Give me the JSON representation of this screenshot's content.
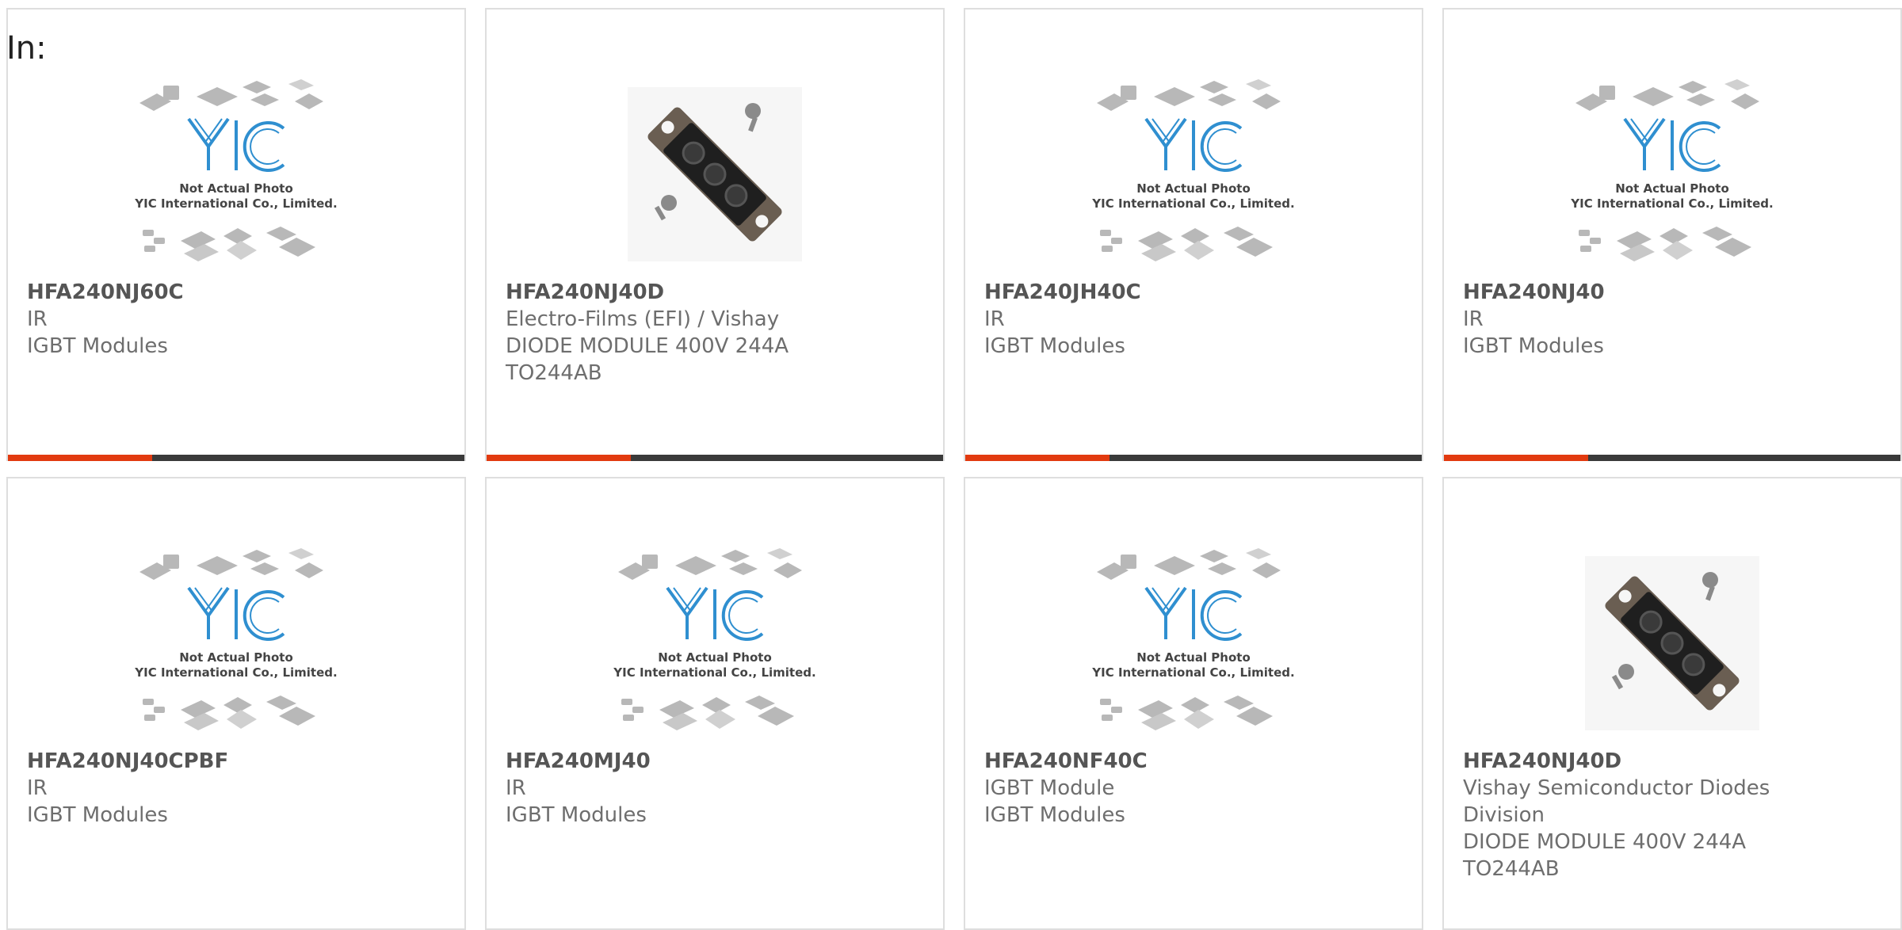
{
  "header": {
    "label": "In:"
  },
  "placeholder_image": {
    "line1": "Not Actual Photo",
    "line2": "YIC International Co., Limited.",
    "logo_text": "YIC"
  },
  "colors": {
    "accent": "#e23a0f",
    "bar_dark": "#3a3a3a",
    "logo_blue": "#2f8fd0",
    "chip_grey": "#b8b8b8"
  },
  "products": [
    {
      "part_number": "HFA240NJ60C",
      "lines": [
        "IR",
        "IGBT Modules"
      ],
      "image": "placeholder-logo-icon"
    },
    {
      "part_number": "HFA240NJ40D",
      "lines": [
        "Electro-Films (EFI) / Vishay",
        "DIODE MODULE 400V 244A",
        "TO244AB"
      ],
      "image": "diode-module-icon"
    },
    {
      "part_number": "HFA240JH40C",
      "lines": [
        "IR",
        "IGBT Modules"
      ],
      "image": "placeholder-logo-icon"
    },
    {
      "part_number": "HFA240NJ40",
      "lines": [
        "IR",
        "IGBT Modules"
      ],
      "image": "placeholder-logo-icon"
    },
    {
      "part_number": "HFA240NJ40CPBF",
      "lines": [
        "IR",
        "IGBT Modules"
      ],
      "image": "placeholder-logo-icon"
    },
    {
      "part_number": "HFA240MJ40",
      "lines": [
        "IR",
        "IGBT Modules"
      ],
      "image": "placeholder-logo-icon"
    },
    {
      "part_number": "HFA240NF40C",
      "lines": [
        "IGBT Module",
        "IGBT Modules"
      ],
      "image": "placeholder-logo-icon"
    },
    {
      "part_number": "HFA240NJ40D",
      "lines": [
        "Vishay Semiconductor Diodes",
        "Division",
        "DIODE MODULE 400V 244A",
        "TO244AB"
      ],
      "image": "diode-module-icon"
    }
  ]
}
